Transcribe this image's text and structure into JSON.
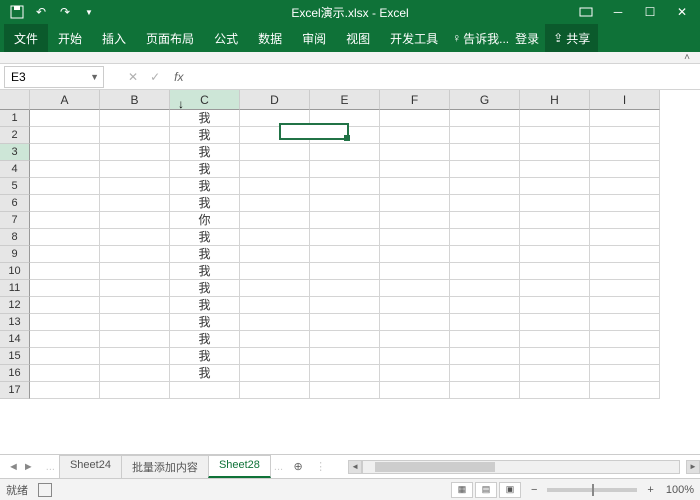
{
  "title": "Excel演示.xlsx - Excel",
  "ribbon": {
    "file": "文件",
    "tabs": [
      "开始",
      "插入",
      "页面布局",
      "公式",
      "数据",
      "审阅",
      "视图",
      "开发工具"
    ],
    "tell": "告诉我...",
    "signin": "登录",
    "share": "共享"
  },
  "namebox": "E3",
  "fx_label": "fx",
  "columns": [
    "A",
    "B",
    "C",
    "D",
    "E",
    "F",
    "G",
    "H",
    "I"
  ],
  "rows": [
    1,
    2,
    3,
    4,
    5,
    6,
    7,
    8,
    9,
    10,
    11,
    12,
    13,
    14,
    15,
    16,
    17
  ],
  "colC": [
    "我",
    "我",
    "我",
    "我",
    "我",
    "我",
    "你",
    "我",
    "我",
    "我",
    "我",
    "我",
    "我",
    "我",
    "我",
    "我",
    ""
  ],
  "active": {
    "col": 4,
    "row": 2
  },
  "selected_col_header": 2,
  "selected_row_header": 2,
  "sheets": {
    "nav_dots": "...",
    "tabs": [
      {
        "name": "Sheet24",
        "active": false
      },
      {
        "name": "批量添加内容",
        "active": false
      },
      {
        "name": "Sheet28",
        "active": true
      }
    ],
    "more": "..."
  },
  "status": {
    "ready": "就绪",
    "zoom": "100%",
    "minus": "−",
    "plus": "+"
  }
}
